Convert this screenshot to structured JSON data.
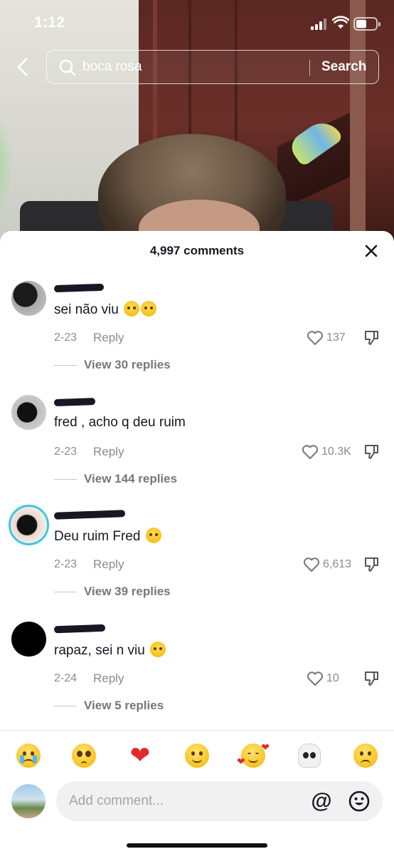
{
  "status_bar": {
    "time": "1:12"
  },
  "search": {
    "query": "boca rosa",
    "button_label": "Search"
  },
  "sheet": {
    "title": "4,997 comments"
  },
  "comments": [
    {
      "text": "sei não viu",
      "date": "2-23",
      "reply_label": "Reply",
      "likes": "137",
      "view_replies": "View 30 replies"
    },
    {
      "text": "fred , acho q deu ruim",
      "date": "2-23",
      "reply_label": "Reply",
      "likes": "10.3K",
      "view_replies": "View 144 replies"
    },
    {
      "text": "Deu ruim Fred",
      "date": "2-23",
      "reply_label": "Reply",
      "likes": "6,613",
      "view_replies": "View 39 replies"
    },
    {
      "text": "rapaz, sei n viu",
      "date": "2-24",
      "reply_label": "Reply",
      "likes": "10",
      "view_replies": "View 5 replies"
    }
  ],
  "emoji_bar": [
    "loudly-crying",
    "pleading",
    "red-heart",
    "slightly-smiling",
    "smiling-with-hearts",
    "skull",
    "frowning"
  ],
  "input": {
    "placeholder": "Add comment..."
  },
  "colors": {
    "text": "#161823",
    "muted": "#8a8b91",
    "avatar_ring": "#3ec7e0",
    "heart": "#e02b2b"
  }
}
